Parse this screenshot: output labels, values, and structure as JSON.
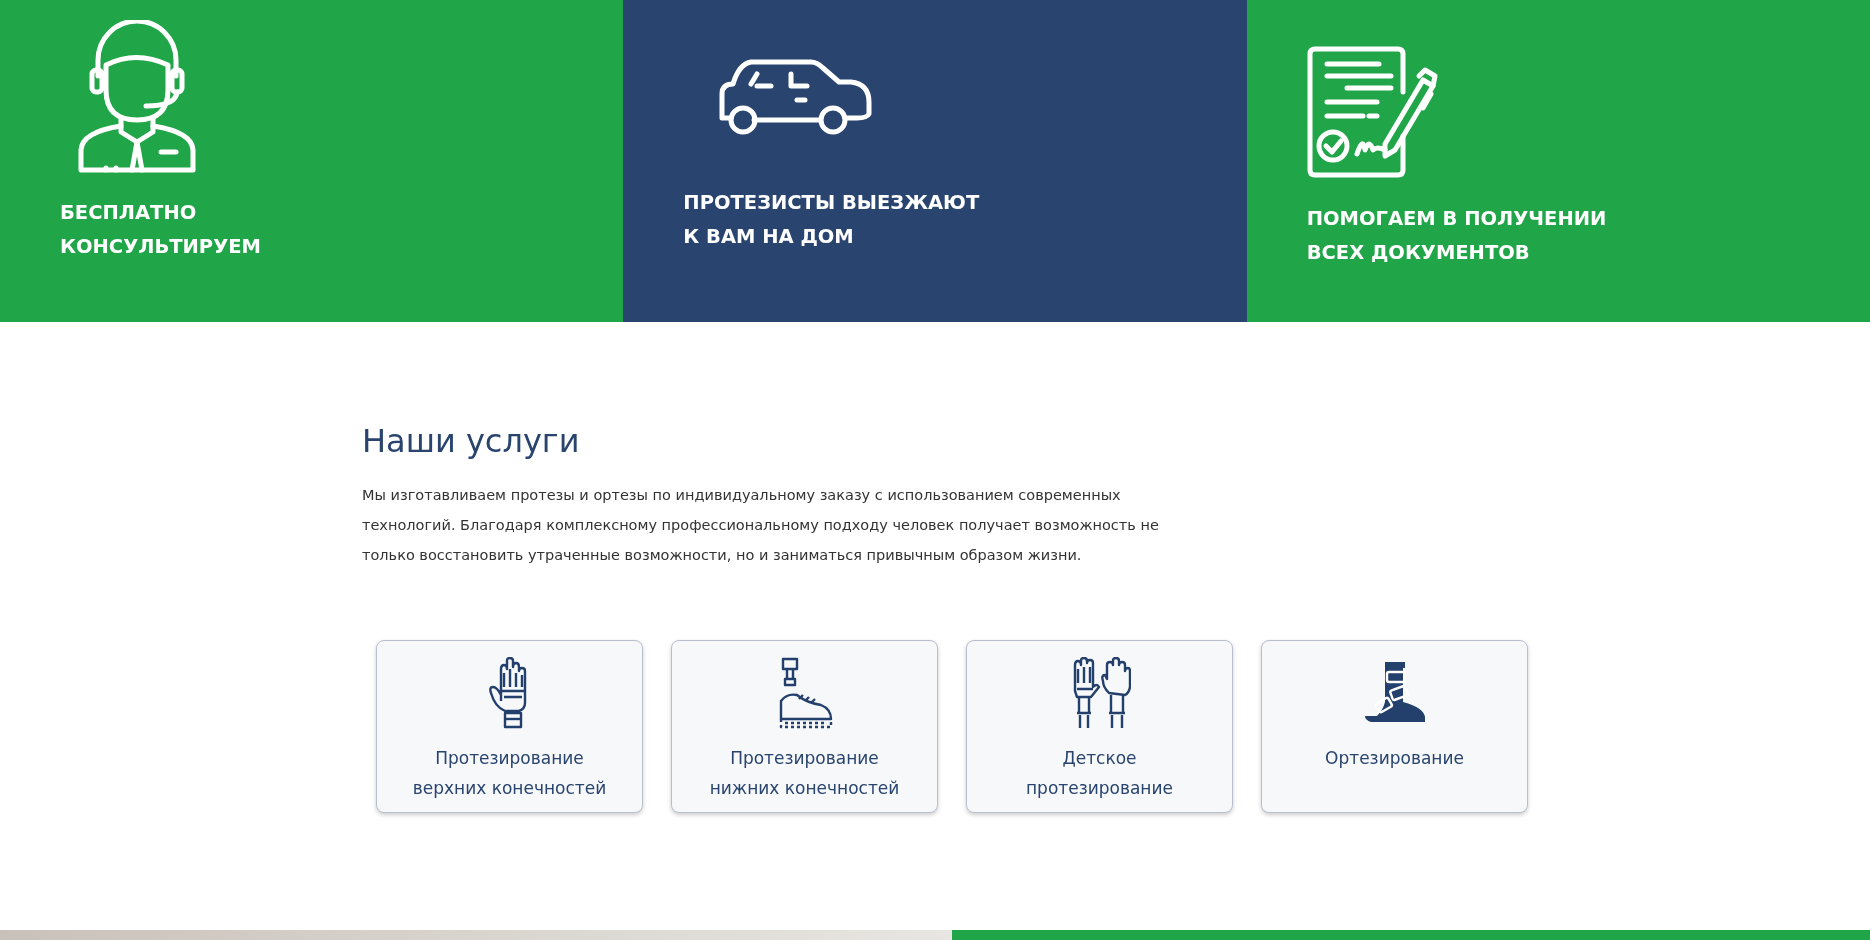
{
  "features": [
    {
      "kind": "consultant",
      "color": "#20a548",
      "lines": [
        "БЕСПЛАТНО",
        "КОНСУЛЬТИРУЕМ"
      ]
    },
    {
      "kind": "car",
      "color": "#29446e",
      "lines": [
        "ПРОТЕЗИСТЫ ВЫЕЗЖАЮТ",
        "К ВАМ НА ДОМ"
      ]
    },
    {
      "kind": "document",
      "color": "#20a548",
      "lines": [
        "ПОМОГАЕМ В ПОЛУЧЕНИИ",
        "ВСЕХ ДОКУМЕНТОВ"
      ]
    }
  ],
  "services": {
    "title": "Наши услуги",
    "text": "Мы изготавливаем протезы и ортезы по индивидуальному заказу с использованием современных технологий. Благодаря комплексному профессиональному подходу человек получает возможность не только восстановить утраченные возможности, но и заниматься привычным образом жизни.",
    "cards": [
      {
        "kind": "hand",
        "lines": [
          "Протезирование",
          "верхних конечностей"
        ]
      },
      {
        "kind": "leg",
        "lines": [
          "Протезирование",
          "нижних конечностей"
        ]
      },
      {
        "kind": "kids",
        "lines": [
          "Детское",
          "протезирование"
        ]
      },
      {
        "kind": "orthosis",
        "lines": [
          "Ортезирование"
        ]
      }
    ]
  }
}
